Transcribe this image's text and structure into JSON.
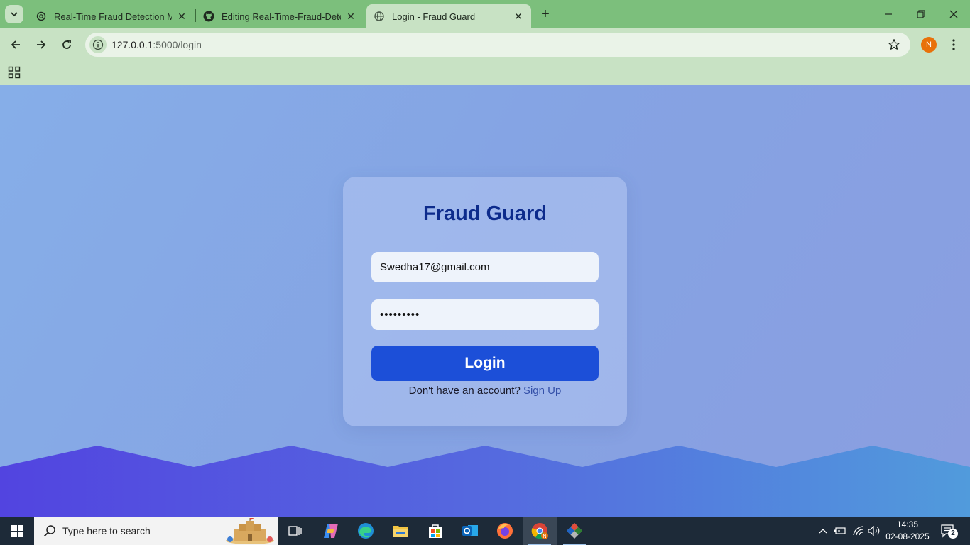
{
  "browser": {
    "tabs": [
      {
        "title": "Real-Time Fraud Detection ML",
        "favicon": "chatgpt-icon",
        "active": false
      },
      {
        "title": "Editing Real-Time-Fraud-Detecti",
        "favicon": "github-icon",
        "active": false
      },
      {
        "title": "Login - Fraud Guard",
        "favicon": "globe-icon",
        "active": true
      }
    ],
    "url_host": "127.0.0.1",
    "url_path": ":5000/login",
    "profile_initial": "N"
  },
  "page": {
    "brand": "Fraud Guard",
    "email_value": "Swedha17@gmail.com",
    "password_value": "•••••••••",
    "login_label": "Login",
    "signup_prompt": "Don't have an account?",
    "signup_link": "Sign Up",
    "colors": {
      "primary": "#1c4fd8",
      "brand": "#0d2b8c"
    }
  },
  "taskbar": {
    "search_placeholder": "Type here to search",
    "time": "14:35",
    "date": "02-08-2025",
    "notification_count": "2"
  }
}
